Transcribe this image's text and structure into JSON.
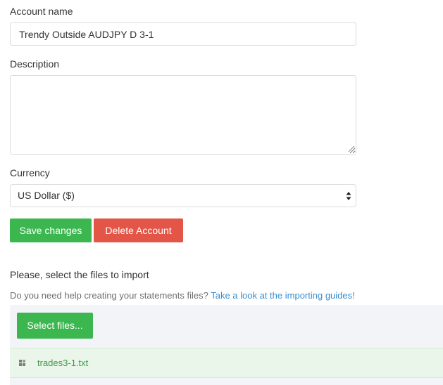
{
  "account": {
    "name_label": "Account name",
    "name_value": "Trendy Outside AUDJPY D 3-1",
    "description_label": "Description",
    "description_value": "",
    "currency_label": "Currency",
    "currency_value": "US Dollar ($)"
  },
  "actions": {
    "save_label": "Save changes",
    "delete_label": "Delete Account"
  },
  "import": {
    "title": "Please, select the files to import",
    "help_text": "Do you need help creating your statements files?",
    "help_link": "Take a look at the importing guides!",
    "select_files_label": "Select files...",
    "files": [
      {
        "name": "trades3-1.txt",
        "icon": "file-grip-icon"
      }
    ]
  },
  "colors": {
    "accent_green": "#3cb750",
    "danger_red": "#e25547",
    "link_blue": "#3a8fd0",
    "file_text_green": "#3c9a4a",
    "upload_bg": "#f2f4f8",
    "file_row_bg": "#e9f6e9"
  }
}
